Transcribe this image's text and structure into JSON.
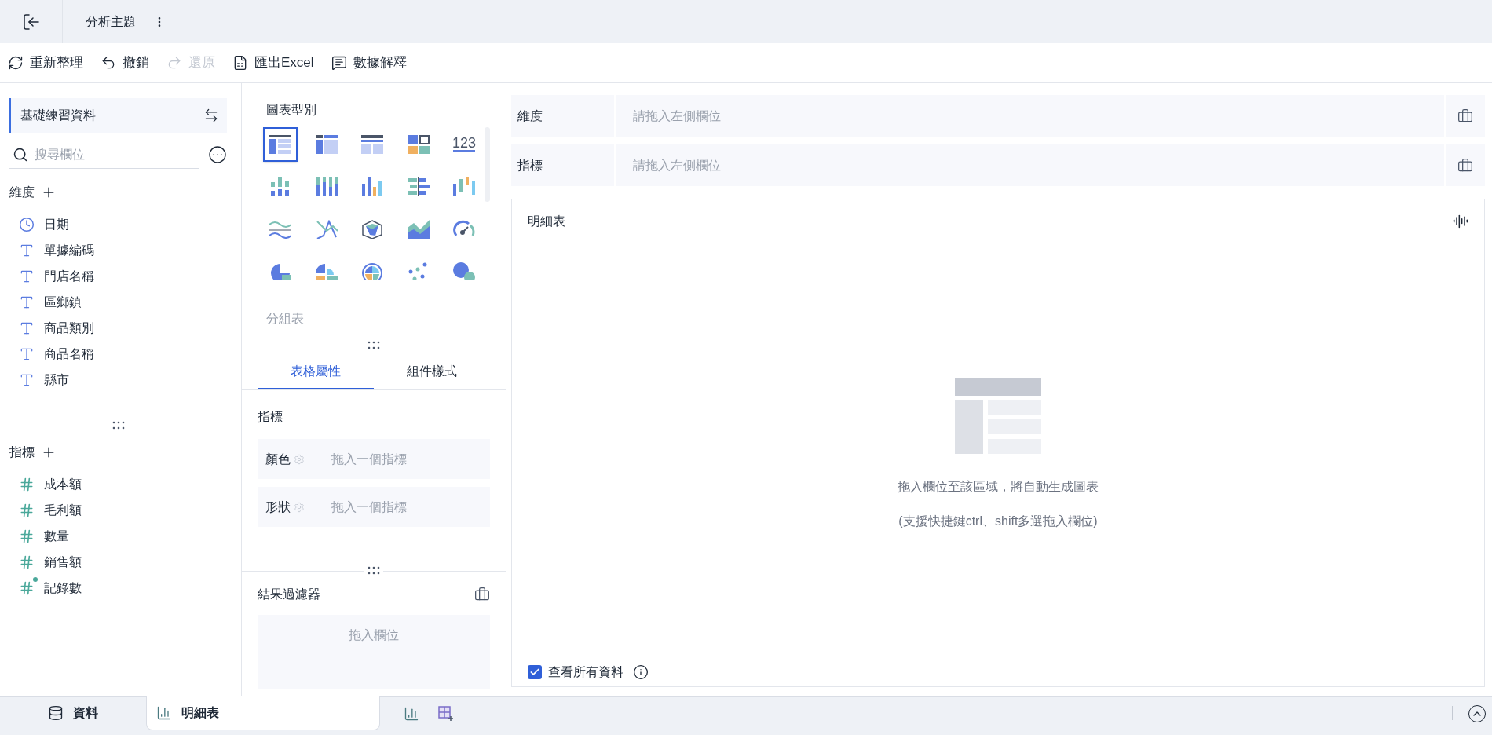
{
  "header": {
    "title": "分析主題"
  },
  "toolbar": [
    {
      "label": "重新整理",
      "disabled": false
    },
    {
      "label": "撤銷",
      "disabled": false
    },
    {
      "label": "還原",
      "disabled": true
    },
    {
      "label": "匯出Excel",
      "disabled": false
    },
    {
      "label": "數據解釋",
      "disabled": false
    }
  ],
  "dataset": {
    "name": "基礎練習資料"
  },
  "search": {
    "placeholder": "搜尋欄位"
  },
  "dimensions": {
    "title": "維度",
    "fields": [
      {
        "name": "日期",
        "kind": "date"
      },
      {
        "name": "單據編碼",
        "kind": "text"
      },
      {
        "name": "門店名稱",
        "kind": "text"
      },
      {
        "name": "區鄉鎮",
        "kind": "text"
      },
      {
        "name": "商品類別",
        "kind": "text"
      },
      {
        "name": "商品名稱",
        "kind": "text"
      },
      {
        "name": "縣市",
        "kind": "text"
      }
    ]
  },
  "measures": {
    "title": "指標",
    "fields": [
      {
        "name": "成本額",
        "kind": "number"
      },
      {
        "name": "毛利額",
        "kind": "number"
      },
      {
        "name": "數量",
        "kind": "number"
      },
      {
        "name": "銷售額",
        "kind": "number"
      },
      {
        "name": "記錄數",
        "kind": "count"
      }
    ]
  },
  "chart_types": {
    "title": "圖表型別",
    "current": "分組表",
    "items": [
      {
        "selected": true
      },
      {
        "selected": false
      },
      {
        "selected": false
      },
      {
        "selected": false
      },
      {
        "selected": false,
        "label": "123"
      },
      {
        "selected": false
      },
      {
        "selected": false
      },
      {
        "selected": false
      },
      {
        "selected": false
      },
      {
        "selected": false
      },
      {
        "selected": false
      },
      {
        "selected": false
      },
      {
        "selected": false
      },
      {
        "selected": false
      },
      {
        "selected": false
      },
      {
        "selected": false
      },
      {
        "selected": false
      },
      {
        "selected": false
      },
      {
        "selected": false
      },
      {
        "selected": false
      }
    ]
  },
  "property_tabs": [
    {
      "label": "表格屬性",
      "selected": true
    },
    {
      "label": "組件樣式",
      "selected": false
    }
  ],
  "properties": {
    "title": "指標",
    "slots": [
      {
        "label": "顏色",
        "hint": "拖入一個指標"
      },
      {
        "label": "形狀",
        "hint": "拖入一個指標"
      }
    ]
  },
  "result_filter": {
    "title": "結果過濾器",
    "hint": "拖入欄位"
  },
  "shelves": [
    {
      "label": "維度",
      "hint": "請拖入左側欄位"
    },
    {
      "label": "指標",
      "hint": "請拖入左側欄位"
    }
  ],
  "chart_card": {
    "title": "明細表",
    "hint": "拖入欄位至該區域，將自動生成圖表",
    "subhint": "(支援快捷鍵ctrl、shift多選拖入欄位)",
    "show_all": {
      "label": "查看所有資料",
      "checked": true
    }
  },
  "bottom_tabs": [
    {
      "label": "資料",
      "selected": false
    },
    {
      "label": "明細表",
      "selected": true
    }
  ]
}
